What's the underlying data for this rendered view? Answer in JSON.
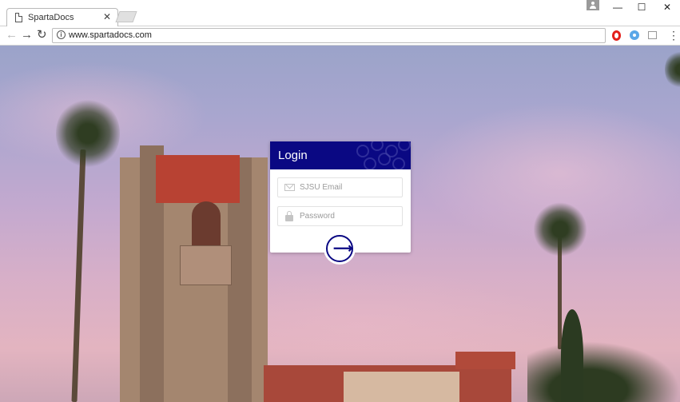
{
  "browser": {
    "tab_title": "SpartaDocs",
    "tab_close": "✕",
    "url": "www.spartadocs.com",
    "nav_back": "←",
    "nav_forward": "→",
    "nav_reload": "↻",
    "minimize": "—",
    "maximize": "☐",
    "close": "✕",
    "menu": "⋮",
    "info_glyph": "i"
  },
  "login": {
    "title": "Login",
    "email_placeholder": "SJSU Email",
    "password_placeholder": "Password",
    "email_value": "",
    "password_value": "",
    "submit_icon": "⟶"
  },
  "colors": {
    "brand": "#0a0883",
    "card": "#ffffff"
  }
}
